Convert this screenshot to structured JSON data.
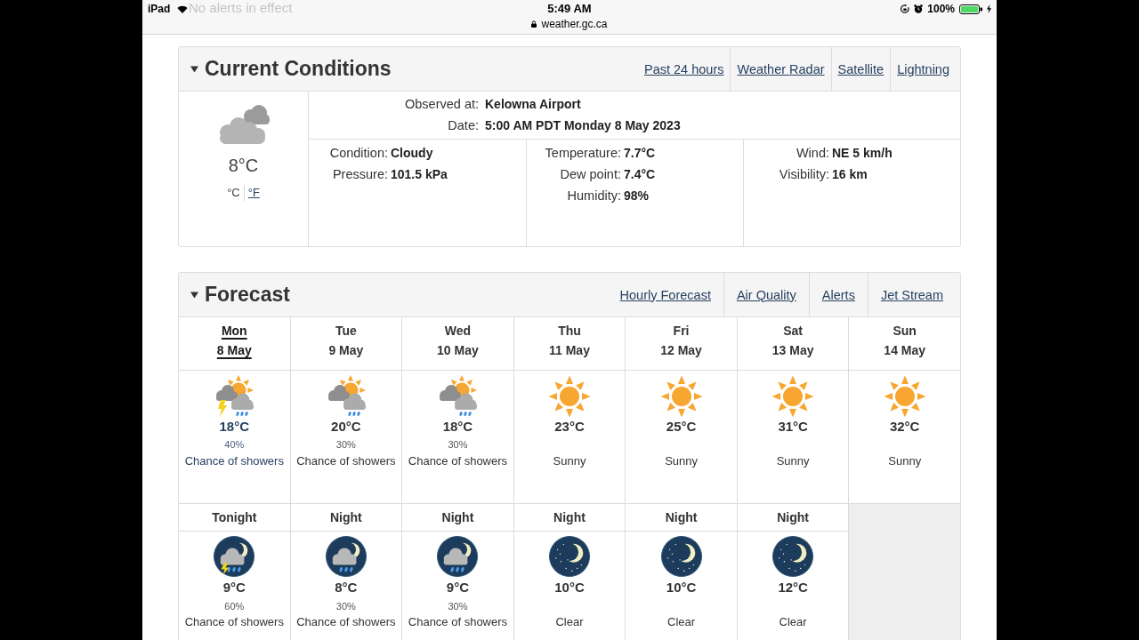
{
  "status_bar": {
    "device": "iPad",
    "time": "5:49 AM",
    "url": "weather.gc.ca",
    "battery": "100%"
  },
  "alert_notice": "No alerts in effect",
  "current_conditions": {
    "title": "Current Conditions",
    "expanded": true,
    "links": [
      "Past 24 hours",
      "Weather Radar",
      "Satellite",
      "Lightning"
    ],
    "temperature": "8°C",
    "units": [
      {
        "label": "°C",
        "selected": true
      },
      {
        "label": "°F",
        "selected": false
      }
    ],
    "observation": [
      {
        "label": "Observed at:",
        "value": "Kelowna Airport"
      },
      {
        "label": "Date:",
        "value": "5:00 AM PDT Monday 8 May 2023"
      }
    ],
    "details": [
      {
        "rows": [
          {
            "label": "Condition:",
            "value": "Cloudy"
          },
          {
            "label": "Pressure:",
            "value": "101.5 kPa"
          }
        ]
      },
      {
        "rows": [
          {
            "label": "Temperature:",
            "value": "7.7°C"
          },
          {
            "label": "Dew point:",
            "value": "7.4°C"
          },
          {
            "label": "Humidity:",
            "value": "98%"
          }
        ]
      },
      {
        "rows": [
          {
            "label": "Wind:",
            "value": "NE 5 km/h"
          },
          {
            "label": "Visibility:",
            "value": "16 km"
          }
        ]
      }
    ]
  },
  "forecast": {
    "title": "Forecast",
    "expanded": true,
    "links": [
      "Hourly Forecast",
      "Air Quality",
      "Alerts",
      "Jet Stream"
    ],
    "days": [
      {
        "day": "Mon",
        "date": "8 May",
        "selected": true,
        "kind": "thunder",
        "temperature": "18°C",
        "pop": "40%",
        "summary": "Chance of showers"
      },
      {
        "day": "Tue",
        "date": "9 May",
        "selected": false,
        "kind": "showers",
        "temperature": "20°C",
        "pop": "30%",
        "summary": "Chance of showers"
      },
      {
        "day": "Wed",
        "date": "10 May",
        "selected": false,
        "kind": "showers",
        "temperature": "18°C",
        "pop": "30%",
        "summary": "Chance of showers"
      },
      {
        "day": "Thu",
        "date": "11 May",
        "selected": false,
        "kind": "sunny",
        "temperature": "23°C",
        "summary": "Sunny"
      },
      {
        "day": "Fri",
        "date": "12 May",
        "selected": false,
        "kind": "sunny",
        "temperature": "25°C",
        "summary": "Sunny"
      },
      {
        "day": "Sat",
        "date": "13 May",
        "selected": false,
        "kind": "sunny",
        "temperature": "31°C",
        "summary": "Sunny"
      },
      {
        "day": "Sun",
        "date": "14 May",
        "selected": false,
        "kind": "sunny",
        "temperature": "32°C",
        "summary": "Sunny"
      }
    ],
    "nights": [
      {
        "label": "Tonight",
        "kind": "thunder",
        "temperature": "9°C",
        "pop": "60%",
        "summary": "Chance of showers"
      },
      {
        "label": "Night",
        "kind": "showers",
        "temperature": "8°C",
        "pop": "30%",
        "summary": "Chance of showers"
      },
      {
        "label": "Night",
        "kind": "showers",
        "temperature": "9°C",
        "pop": "30%",
        "summary": "Chance of showers"
      },
      {
        "label": "Night",
        "kind": "clear",
        "temperature": "10°C",
        "summary": "Clear"
      },
      {
        "label": "Night",
        "kind": "clear",
        "temperature": "10°C",
        "summary": "Clear"
      },
      {
        "label": "Night",
        "kind": "clear",
        "temperature": "12°C",
        "summary": "Clear"
      }
    ]
  }
}
